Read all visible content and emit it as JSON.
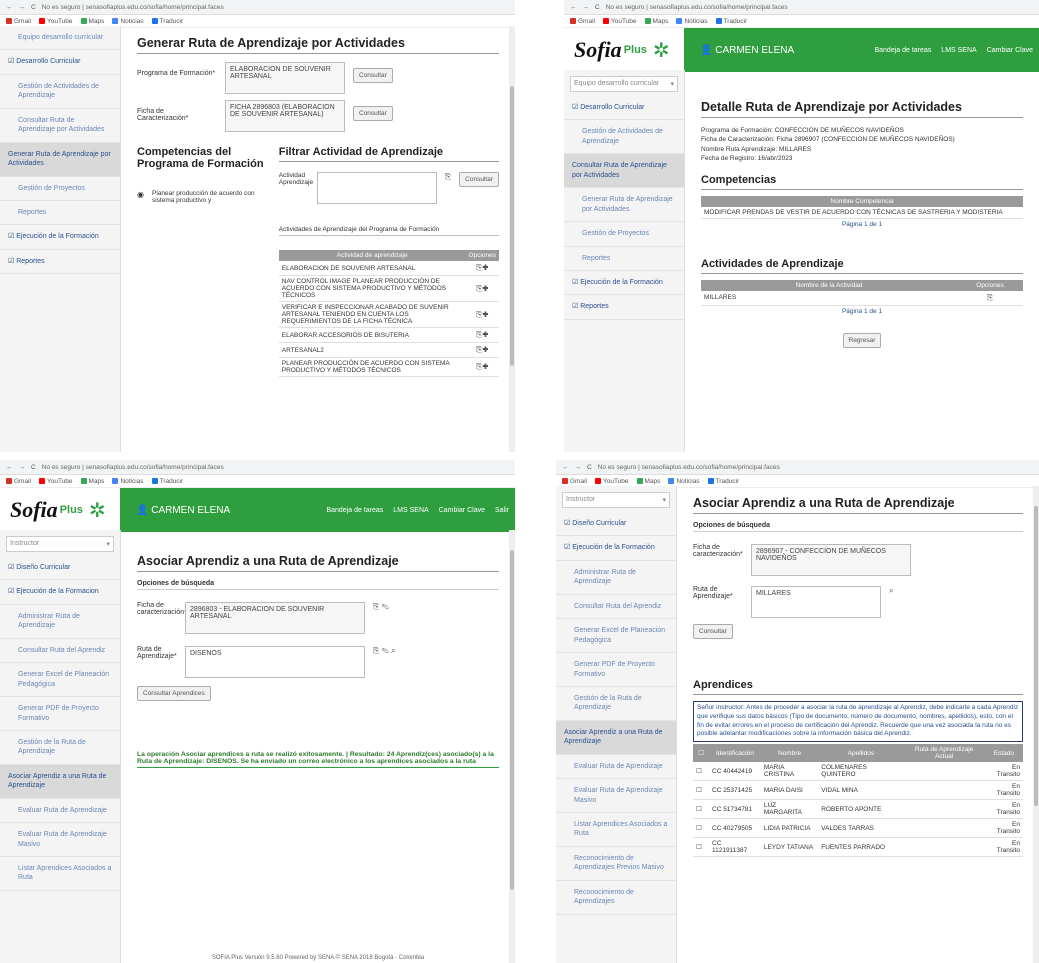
{
  "browser": {
    "url": "No es seguro | senasofiaplus.edu.co/sofia/home/principal.faces",
    "bookmarks": [
      "Gmail",
      "YouTube",
      "Maps",
      "Noticias",
      "Traducir"
    ]
  },
  "header": {
    "logo_text": "Sofia",
    "logo_plus": "Plus",
    "user": "CARMEN ELENA",
    "links": [
      "Bandeja de tareas",
      "LMS SENA",
      "Cambiar Clave",
      "Salir"
    ]
  },
  "q1": {
    "sidebar": [
      {
        "label": "Equipo desarrollo curricular",
        "kind": "sub"
      },
      {
        "label": "Desarrollo Curricular",
        "kind": "main"
      },
      {
        "label": "Gestión de Actividades de Aprendizaje",
        "kind": "sub"
      },
      {
        "label": "Consultar Ruta de Aprendizaje por Actividades",
        "kind": "sub"
      },
      {
        "label": "Generar Ruta de Aprendizaje por Actividades",
        "kind": "active"
      },
      {
        "label": "Gestión de Proyectos",
        "kind": "sub"
      },
      {
        "label": "Reportes",
        "kind": "sub"
      },
      {
        "label": "Ejecución de la Formación",
        "kind": "main"
      },
      {
        "label": "Reportes",
        "kind": "main"
      }
    ],
    "title": "Generar Ruta de Aprendizaje por Actividades",
    "programa_label": "Programa de Formación*",
    "programa_value": "ELABORACION DE SOUVENIR ARTESANAL",
    "ficha_label": "Ficha de Caracterización*",
    "ficha_value": "FICHA 2896803 (ELABORACION DE SOUVENIR ARTESANAL)",
    "consultar": "Consultar",
    "competencias_title": "Competencias del Programa de Formación",
    "competencia_item": "Planear producción de acuerdo con sistema productivo y",
    "filtrar_title": "Filtrar Actividad de Aprendizaje",
    "actividad_label": "Actividad Aprendizaje",
    "actividades_caption": "Actividades de Aprendizaje del Programa de Formación",
    "table_headers": [
      "Actividad de aprendizaje",
      "Opciones"
    ],
    "activities": [
      "ELABORACION DE SOUVENIR ARTESANAL",
      "NAV CONTROL IMAGE PLANEAR PRODUCCIÓN DE ACUERDO CON SISTEMA PRODUCTIVO Y MÉTODOS TÉCNICOS",
      "VERIFICAR E INSPECCIONAR ACABADO DE SUVENIR ARTESANAL TENIENDO EN CUENTA LOS REQUERIMIENTOS DE LA FICHA TÉCNICA",
      "ELABORAR ACCESORIOS DE BISUTERIA",
      "ARTESANAL2",
      "PLANEAR PRODUCCIÓN DE ACUERDO CON SISTEMA PRODUCTIVO Y MÉTODOS TÉCNICOS"
    ]
  },
  "q2": {
    "sidebar": [
      {
        "label": "Equipo desarrollo curricular",
        "kind": "select"
      },
      {
        "label": "Desarrollo Curricular",
        "kind": "main"
      },
      {
        "label": "Gestión de Actividades de Aprendizaje",
        "kind": "sub"
      },
      {
        "label": "Consultar Ruta de Aprendizaje por Actividades",
        "kind": "active"
      },
      {
        "label": "Generar Ruta de Aprendizaje por Actividades",
        "kind": "sub"
      },
      {
        "label": "Gestión de Proyectos",
        "kind": "sub"
      },
      {
        "label": "Reportes",
        "kind": "sub"
      },
      {
        "label": "Ejecución de la Formación",
        "kind": "main"
      },
      {
        "label": "Reportes",
        "kind": "main"
      }
    ],
    "title": "Detalle Ruta de Aprendizaje por Actividades",
    "details": [
      "Programa de Formación: CONFECCION DE MUÑECOS NAVIDEÑOS",
      "Ficha de Caracterización: Ficha 2896907 (CONFECCION DE MUÑECOS NAVIDEÑOS)",
      "Nombre Ruta Aprendizaje: MILLARES",
      "Fecha de Registro: 16/abr/2023"
    ],
    "competencias_title": "Competencias",
    "competencias_header": "Nombre Competencia",
    "competencia": "MODIFICAR PRENDAS DE VESTIR DE ACUERDO CON TÉCNICAS DE SASTRERIA Y MODISTERIA",
    "pager": "Página 1 de 1",
    "actividades_title": "Actividades de Aprendizaje",
    "actividades_headers": [
      "Nombre de la Actividad",
      "Opciones"
    ],
    "actividad": "MILLARES",
    "regresar": "Regresar"
  },
  "q3": {
    "sidebar": [
      {
        "label": "Instructor",
        "kind": "select"
      },
      {
        "label": "Diseño Curricular",
        "kind": "main"
      },
      {
        "label": "Ejecución de la Formacion",
        "kind": "main"
      },
      {
        "label": "Administrar Ruta de Aprendizaje",
        "kind": "sub"
      },
      {
        "label": "Consultar Ruta del Aprendiz",
        "kind": "sub"
      },
      {
        "label": "Generar Excel de Planeación Pedagógica",
        "kind": "sub"
      },
      {
        "label": "Generar PDF de Proyecto Formativo",
        "kind": "sub"
      },
      {
        "label": "Gestión de la Ruta de Aprendizaje",
        "kind": "sub"
      },
      {
        "label": "Asociar Aprendiz a una Ruta de Aprendizaje",
        "kind": "active"
      },
      {
        "label": "Evaluar Ruta de Aprendizaje",
        "kind": "sub"
      },
      {
        "label": "Evaluar Ruta de Aprendizaje Masivo",
        "kind": "sub"
      },
      {
        "label": "Listar Aprendices Asociados a Ruta",
        "kind": "sub"
      }
    ],
    "title": "Asociar Aprendiz a una Ruta de Aprendizaje",
    "opciones": "Opciones de búsqueda",
    "ficha_label": "Ficha de caracterización*",
    "ficha_value": "2896803 - ELABORACION DE SOUVENIR ARTESANAL",
    "ruta_label": "Ruta de Aprendizaje*",
    "ruta_value": "DISENOS",
    "consultar": "Consultar Aprendices",
    "notice": "La operación Asociar aprendices a ruta se realizó exitosamente. | Resultado: 24 Aprendiz(ces) asociado(s) a la Ruta de Aprendizaje: DISENOS. Se ha enviado un correo electrónico a los aprendices asociados a la ruta",
    "footer": "SOFIA Plus Versión 9.5.60 Powered by SENA © SENA 2018 Bogotá - Colombia"
  },
  "q4": {
    "sidebar": [
      {
        "label": "Instructor",
        "kind": "select"
      },
      {
        "label": "Diseño Curricular",
        "kind": "main"
      },
      {
        "label": "Ejecución de la Formación",
        "kind": "main"
      },
      {
        "label": "Administrar Ruta de Aprendizaje",
        "kind": "sub"
      },
      {
        "label": "Consultar Ruta del Aprendiz",
        "kind": "sub"
      },
      {
        "label": "Generar Excel de Planeación Pedagógica",
        "kind": "sub"
      },
      {
        "label": "Generar PDF de Proyecto Formativo",
        "kind": "sub"
      },
      {
        "label": "Gestión de la Ruta de Aprendizaje",
        "kind": "sub"
      },
      {
        "label": "Asociar Aprendiz a una Ruta de Aprendizaje",
        "kind": "active"
      },
      {
        "label": "Evaluar Ruta de Aprendizaje",
        "kind": "sub"
      },
      {
        "label": "Evaluar Ruta de Aprendizaje Masivo",
        "kind": "sub"
      },
      {
        "label": "Listar Aprendices Asociados a Ruta",
        "kind": "sub"
      },
      {
        "label": "Reconocimiento de Aprendizajes Previos Masivo",
        "kind": "sub"
      },
      {
        "label": "Reconocimiento de Aprendizajes",
        "kind": "sub"
      }
    ],
    "title": "Asociar Aprendiz a una Ruta de Aprendizaje",
    "opciones": "Opciones de búsqueda",
    "ficha_label": "Ficha de caracterización*",
    "ficha_value": "2896907 - CONFECCION DE MUÑECOS NAVIDEÑOS",
    "ruta_label": "Ruta de Aprendizaje*",
    "ruta_value": "MILLARES",
    "consultar": "Consultar",
    "aprendices_title": "Aprendices",
    "alert": "Señor instructor: Antes de proceder a asociar la ruta de aprendizaje al Aprendiz, debe indicarle a cada Aprendiz que verifique sus datos básicos (Tipo de documento, número de documento, nombres, apellidos), esto, con el fin de evitar errores en el proceso de certificación del Aprendiz. Recuerde que una vez asociada la ruta no es posible adelantar modificaciones sobre la información básica del Aprendiz.",
    "table_headers": [
      "",
      "Identificación",
      "Nombre",
      "Apellidos",
      "Ruta de Aprendizaje Actual",
      "Estado"
    ],
    "rows": [
      [
        "CC 40442419",
        "MARIA CRISTINA",
        "COLMENARES QUINTERO",
        "",
        "En Transito"
      ],
      [
        "CC 25371425",
        "MARIA DAISI",
        "VIDAL MINA",
        "",
        "En Transito"
      ],
      [
        "CC 51734781",
        "LUZ MARGARITA",
        "ROBERTO APONTE",
        "",
        "En Transito"
      ],
      [
        "CC 40279505",
        "LIDIA PATRICIA",
        "VALDES TARRAS",
        "",
        "En Transito"
      ],
      [
        "CC 1121911387",
        "LEYDY TATIANA",
        "FUENTES PARRADO",
        "",
        "En Transito"
      ]
    ]
  }
}
